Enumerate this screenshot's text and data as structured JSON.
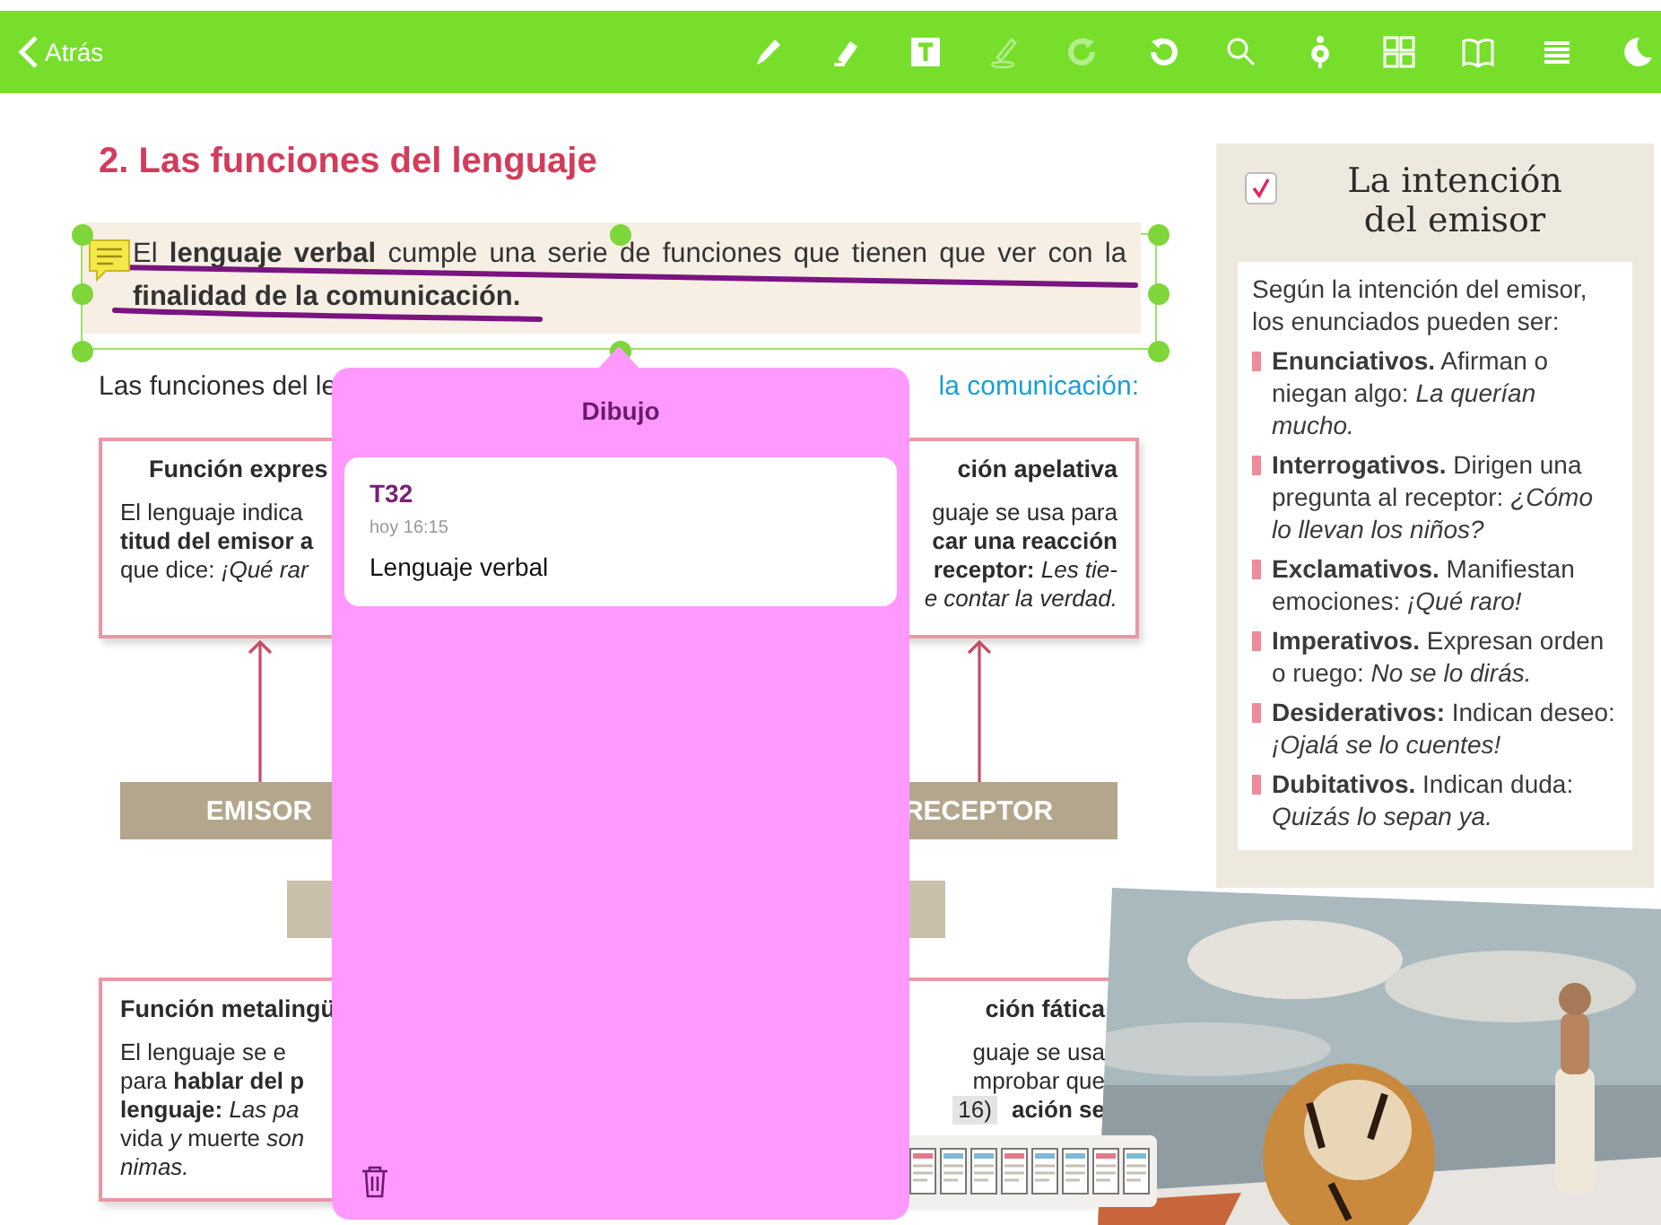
{
  "top_bar": {
    "back_label": "Atrás",
    "tools": [
      {
        "disabled": false
      },
      {
        "disabled": false
      },
      {
        "disabled": false
      },
      {
        "disabled": true
      },
      {
        "disabled": true
      },
      {
        "disabled": false
      },
      {
        "disabled": false
      },
      {
        "disabled": false
      },
      {
        "disabled": false
      },
      {
        "disabled": false
      },
      {
        "disabled": false
      },
      {
        "disabled": false
      }
    ]
  },
  "page": {
    "heading": "2. Las funciones del lenguaje",
    "highlight": {
      "text": "El **lenguaje verbal** cumple una serie de funciones que tienen que ver con la **finalidad de la comunicación.**",
      "selected": true
    },
    "intro": {
      "text": "Las funciones del le",
      "link": "la comunicación:"
    },
    "top_boxes": [
      {
        "kind": "left",
        "title": "Función expres",
        "lines": [
          "El lenguaje indica",
          "**titud del emisor a**",
          "que dice: *¡Qué rar*"
        ]
      },
      {
        "kind": "right",
        "title": "ción apelativa",
        "lines": [
          "guaje se usa para",
          "**car una reacción**",
          "**receptor:** *Les tie-*",
          "*e contar la verdad.*"
        ]
      }
    ],
    "emisor_bar": "EMISOR",
    "receptor_bar": "RECEPTOR",
    "bottom_boxes": [
      {
        "kind": "left",
        "title": "Función metalingü",
        "lines": [
          "El lenguaje se e",
          "para **hablar del p**",
          "**lenguaje:** *Las pa*",
          "vida *y* muerte *son*",
          "*nimas.*"
        ]
      },
      {
        "kind": "right",
        "title": "ción fática",
        "lines": [
          "guaje se usa",
          "mprobar que"
        ],
        "tag": "16)",
        "tag_line": "**ación se**"
      }
    ]
  },
  "sidebar": {
    "checked": true,
    "title": "La intención del emisor",
    "intro": "Según la intención del emisor, los enunciados pueden ser:",
    "items": [
      "**Enunciativos.** Afirman o niegan algo: *La querían mucho.*",
      "**Interrogativos.** Dirigen una pregunta al receptor: *¿Cómo lo llevan los niños?*",
      "**Exclamativos.** Manifiestan emociones: *¡Qué raro!*",
      "**Imperativos.** Expresan orden o ruego: *No se lo dirás.*",
      "**Desiderativos:** Indican deseo: *¡Ojalá se lo cuentes!*",
      "**Dubitativos.** Indican duda: *Quizás lo sepan ya.*"
    ]
  },
  "popover": {
    "title": "Dibujo",
    "note": {
      "tag": "T32",
      "time": "hoy 16:15",
      "text": "Lenguaje verbal"
    }
  }
}
